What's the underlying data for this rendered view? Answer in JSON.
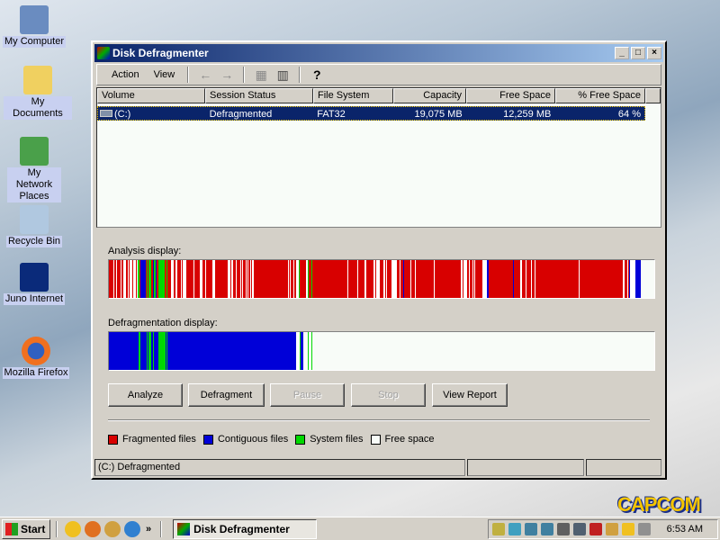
{
  "desktop": {
    "icons": [
      {
        "label": "My Computer"
      },
      {
        "label": "My Documents"
      },
      {
        "label": "My Network Places"
      },
      {
        "label": "Recycle Bin"
      },
      {
        "label": "Juno Internet"
      },
      {
        "label": "Mozilla Firefox"
      }
    ],
    "wallpaper_logo": "CAPCOM"
  },
  "window": {
    "title": "Disk Defragmenter",
    "menu": [
      "Action",
      "View"
    ],
    "columns": [
      "Volume",
      "Session Status",
      "File System",
      "Capacity",
      "Free Space",
      "% Free Space"
    ],
    "rows": [
      {
        "volume": "(C:)",
        "status": "Defragmented",
        "fs": "FAT32",
        "capacity": "19,075 MB",
        "free": "12,259 MB",
        "pct": "64 %"
      }
    ],
    "analysis_label": "Analysis display:",
    "defrag_label": "Defragmentation display:",
    "buttons": {
      "analyze": "Analyze",
      "defragment": "Defragment",
      "pause": "Pause",
      "stop": "Stop",
      "report": "View Report"
    },
    "legend": [
      {
        "label": "Fragmented files",
        "color": "#d80000"
      },
      {
        "label": "Contiguous files",
        "color": "#0000d8"
      },
      {
        "label": "System files",
        "color": "#00d800"
      },
      {
        "label": "Free space",
        "color": "#f8fcf8"
      }
    ],
    "status": "(C:) Defragmented"
  },
  "taskbar": {
    "start": "Start",
    "task": "Disk Defragmenter",
    "clock": "6:53 AM",
    "more": "»"
  }
}
